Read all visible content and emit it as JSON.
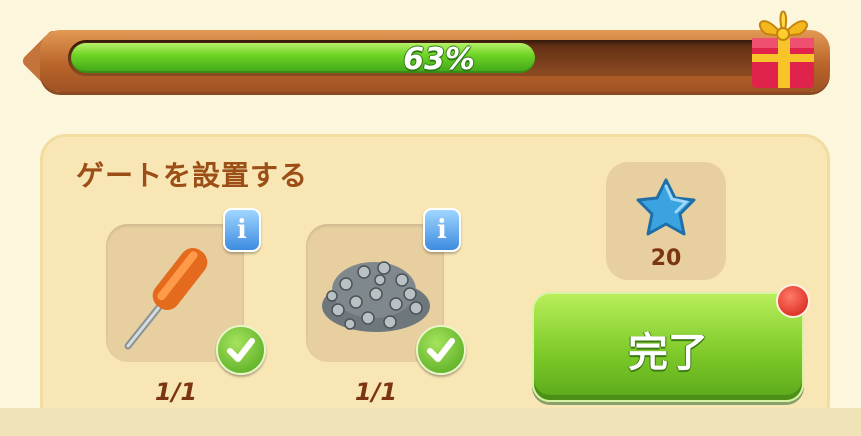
{
  "progress": {
    "percent_label": "63%",
    "fraction": 0.63
  },
  "task": {
    "title": "ゲートを設置する",
    "items": [
      {
        "icon": "screwdriver-icon",
        "count": "1/1",
        "completed": true
      },
      {
        "icon": "screws-icon",
        "count": "1/1",
        "completed": true
      }
    ]
  },
  "reward": {
    "icon": "blue-star-icon",
    "value": "20"
  },
  "complete_button": {
    "label": "完了"
  },
  "colors": {
    "progress_green": "#6ed425",
    "accent_brown": "#9b4e16",
    "button_green": "#7fcb2a",
    "notification_red": "#d21a10"
  }
}
